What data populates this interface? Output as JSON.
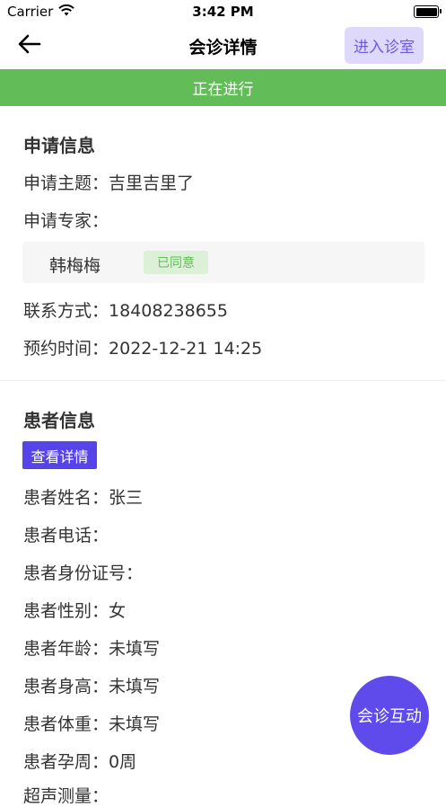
{
  "status_bar": {
    "carrier": "Carrier",
    "time": "3:42 PM"
  },
  "nav": {
    "title": "会诊详情",
    "enter_button": "进入诊室"
  },
  "banner": {
    "status": "正在进行"
  },
  "application": {
    "title": "申请信息",
    "subject_label": "申请主题：",
    "subject_value": "吉里吉里了",
    "expert_label": "申请专家：",
    "expert_name": "韩梅梅",
    "expert_status": "已同意",
    "contact_label": "联系方式：",
    "contact_value": "18408238655",
    "appointment_label": "预约时间：",
    "appointment_value": "2022-12-21 14:25"
  },
  "patient": {
    "title": "患者信息",
    "detail_button": "查看详情",
    "name_label": "患者姓名：",
    "name_value": "张三",
    "phone_label": "患者电话：",
    "phone_value": "",
    "id_label": "患者身份证号：",
    "id_value": "",
    "gender_label": "患者性别：",
    "gender_value": "女",
    "age_label": "患者年龄：",
    "age_value": "未填写",
    "height_label": "患者身高：",
    "height_value": "未填写",
    "weight_label": "患者体重：",
    "weight_value": "未填写",
    "gestation_label": "患者孕周：",
    "gestation_value": "0周",
    "ultrasound_label": "超声测量："
  },
  "fab": {
    "label": "会诊互动"
  },
  "colors": {
    "banner": "#62bd58",
    "accent": "#5f4bec",
    "enter_button_bg": "#ded9fb"
  }
}
